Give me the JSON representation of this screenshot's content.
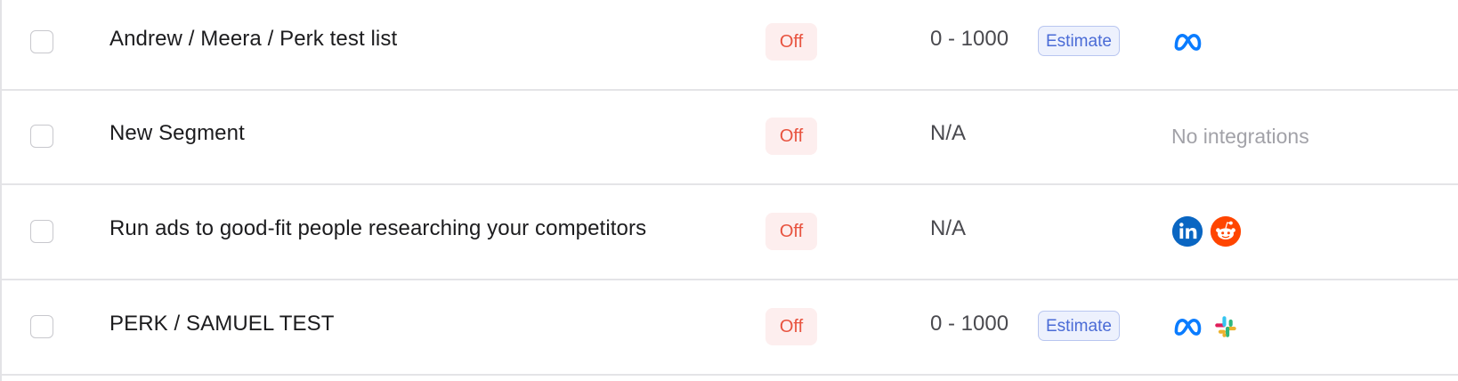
{
  "rows": [
    {
      "name": "Andrew / Meera / Perk test list",
      "status": "Off",
      "size": "0 - 1000",
      "estimate_label": "Estimate",
      "integrations": [
        "meta-icon"
      ]
    },
    {
      "name": "New Segment",
      "status": "Off",
      "size": "N/A",
      "estimate_label": "",
      "integrations": [],
      "no_integrations_text": "No integrations"
    },
    {
      "name": "Run ads to good-fit people researching your competitors",
      "status": "Off",
      "size": "N/A",
      "estimate_label": "",
      "integrations": [
        "linkedin-icon",
        "reddit-icon"
      ]
    },
    {
      "name": "PERK / SAMUEL TEST",
      "status": "Off",
      "size": "0 - 1000",
      "estimate_label": "Estimate",
      "integrations": [
        "meta-icon",
        "slack-icon"
      ]
    }
  ],
  "colors": {
    "status_off_text": "#e8533f",
    "status_off_bg": "#fdeeee",
    "estimate_text": "#4a6bd6",
    "estimate_bg": "#edf1fd",
    "meta": "#0a7cff",
    "linkedin": "#0a66c2",
    "reddit": "#ff4500"
  }
}
